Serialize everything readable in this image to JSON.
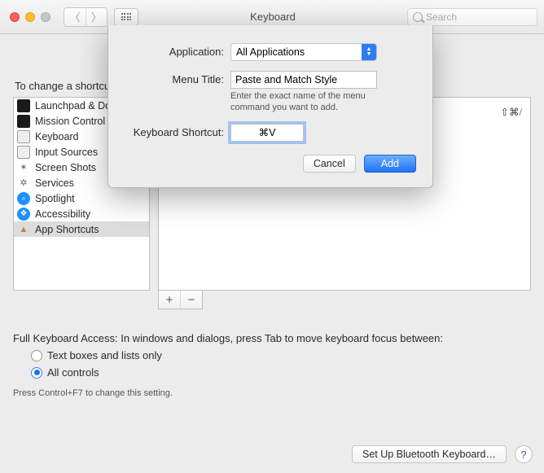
{
  "window": {
    "title": "Keyboard",
    "search_placeholder": "Search"
  },
  "intro": "To change a shortcut, select it, double-click the key combination, and enter the new keys.",
  "source_list": [
    {
      "icon": "launchpad-icon",
      "label": "Launchpad & Dock"
    },
    {
      "icon": "mission-control-icon",
      "label": "Mission Control"
    },
    {
      "icon": "keyboard-icon",
      "label": "Keyboard"
    },
    {
      "icon": "input-sources-icon",
      "label": "Input Sources"
    },
    {
      "icon": "screenshots-icon",
      "label": "Screen Shots"
    },
    {
      "icon": "services-icon",
      "label": "Services"
    },
    {
      "icon": "spotlight-icon",
      "label": "Spotlight"
    },
    {
      "icon": "accessibility-icon",
      "label": "Accessibility"
    },
    {
      "icon": "app-shortcuts-icon",
      "label": "App Shortcuts"
    }
  ],
  "selected_source_index": 8,
  "right_panel": {
    "display_shortcut": "⇧⌘/"
  },
  "plus_minus": {
    "add": "+",
    "remove": "−"
  },
  "fka": {
    "heading": "Full Keyboard Access: In windows and dialogs, press Tab to move keyboard focus between:",
    "options": [
      {
        "label": "Text boxes and lists only"
      },
      {
        "label": "All controls"
      }
    ],
    "selected_index": 1,
    "hint": "Press Control+F7 to change this setting."
  },
  "footer": {
    "bluetooth_button": "Set Up Bluetooth Keyboard…"
  },
  "sheet": {
    "application_label": "Application:",
    "application_value": "All Applications",
    "menu_title_label": "Menu Title:",
    "menu_title_value": "Paste and Match Style",
    "menu_title_hint": "Enter the exact name of the menu command you want to add.",
    "shortcut_label": "Keyboard Shortcut:",
    "shortcut_value": "⌘V",
    "cancel": "Cancel",
    "add": "Add"
  }
}
